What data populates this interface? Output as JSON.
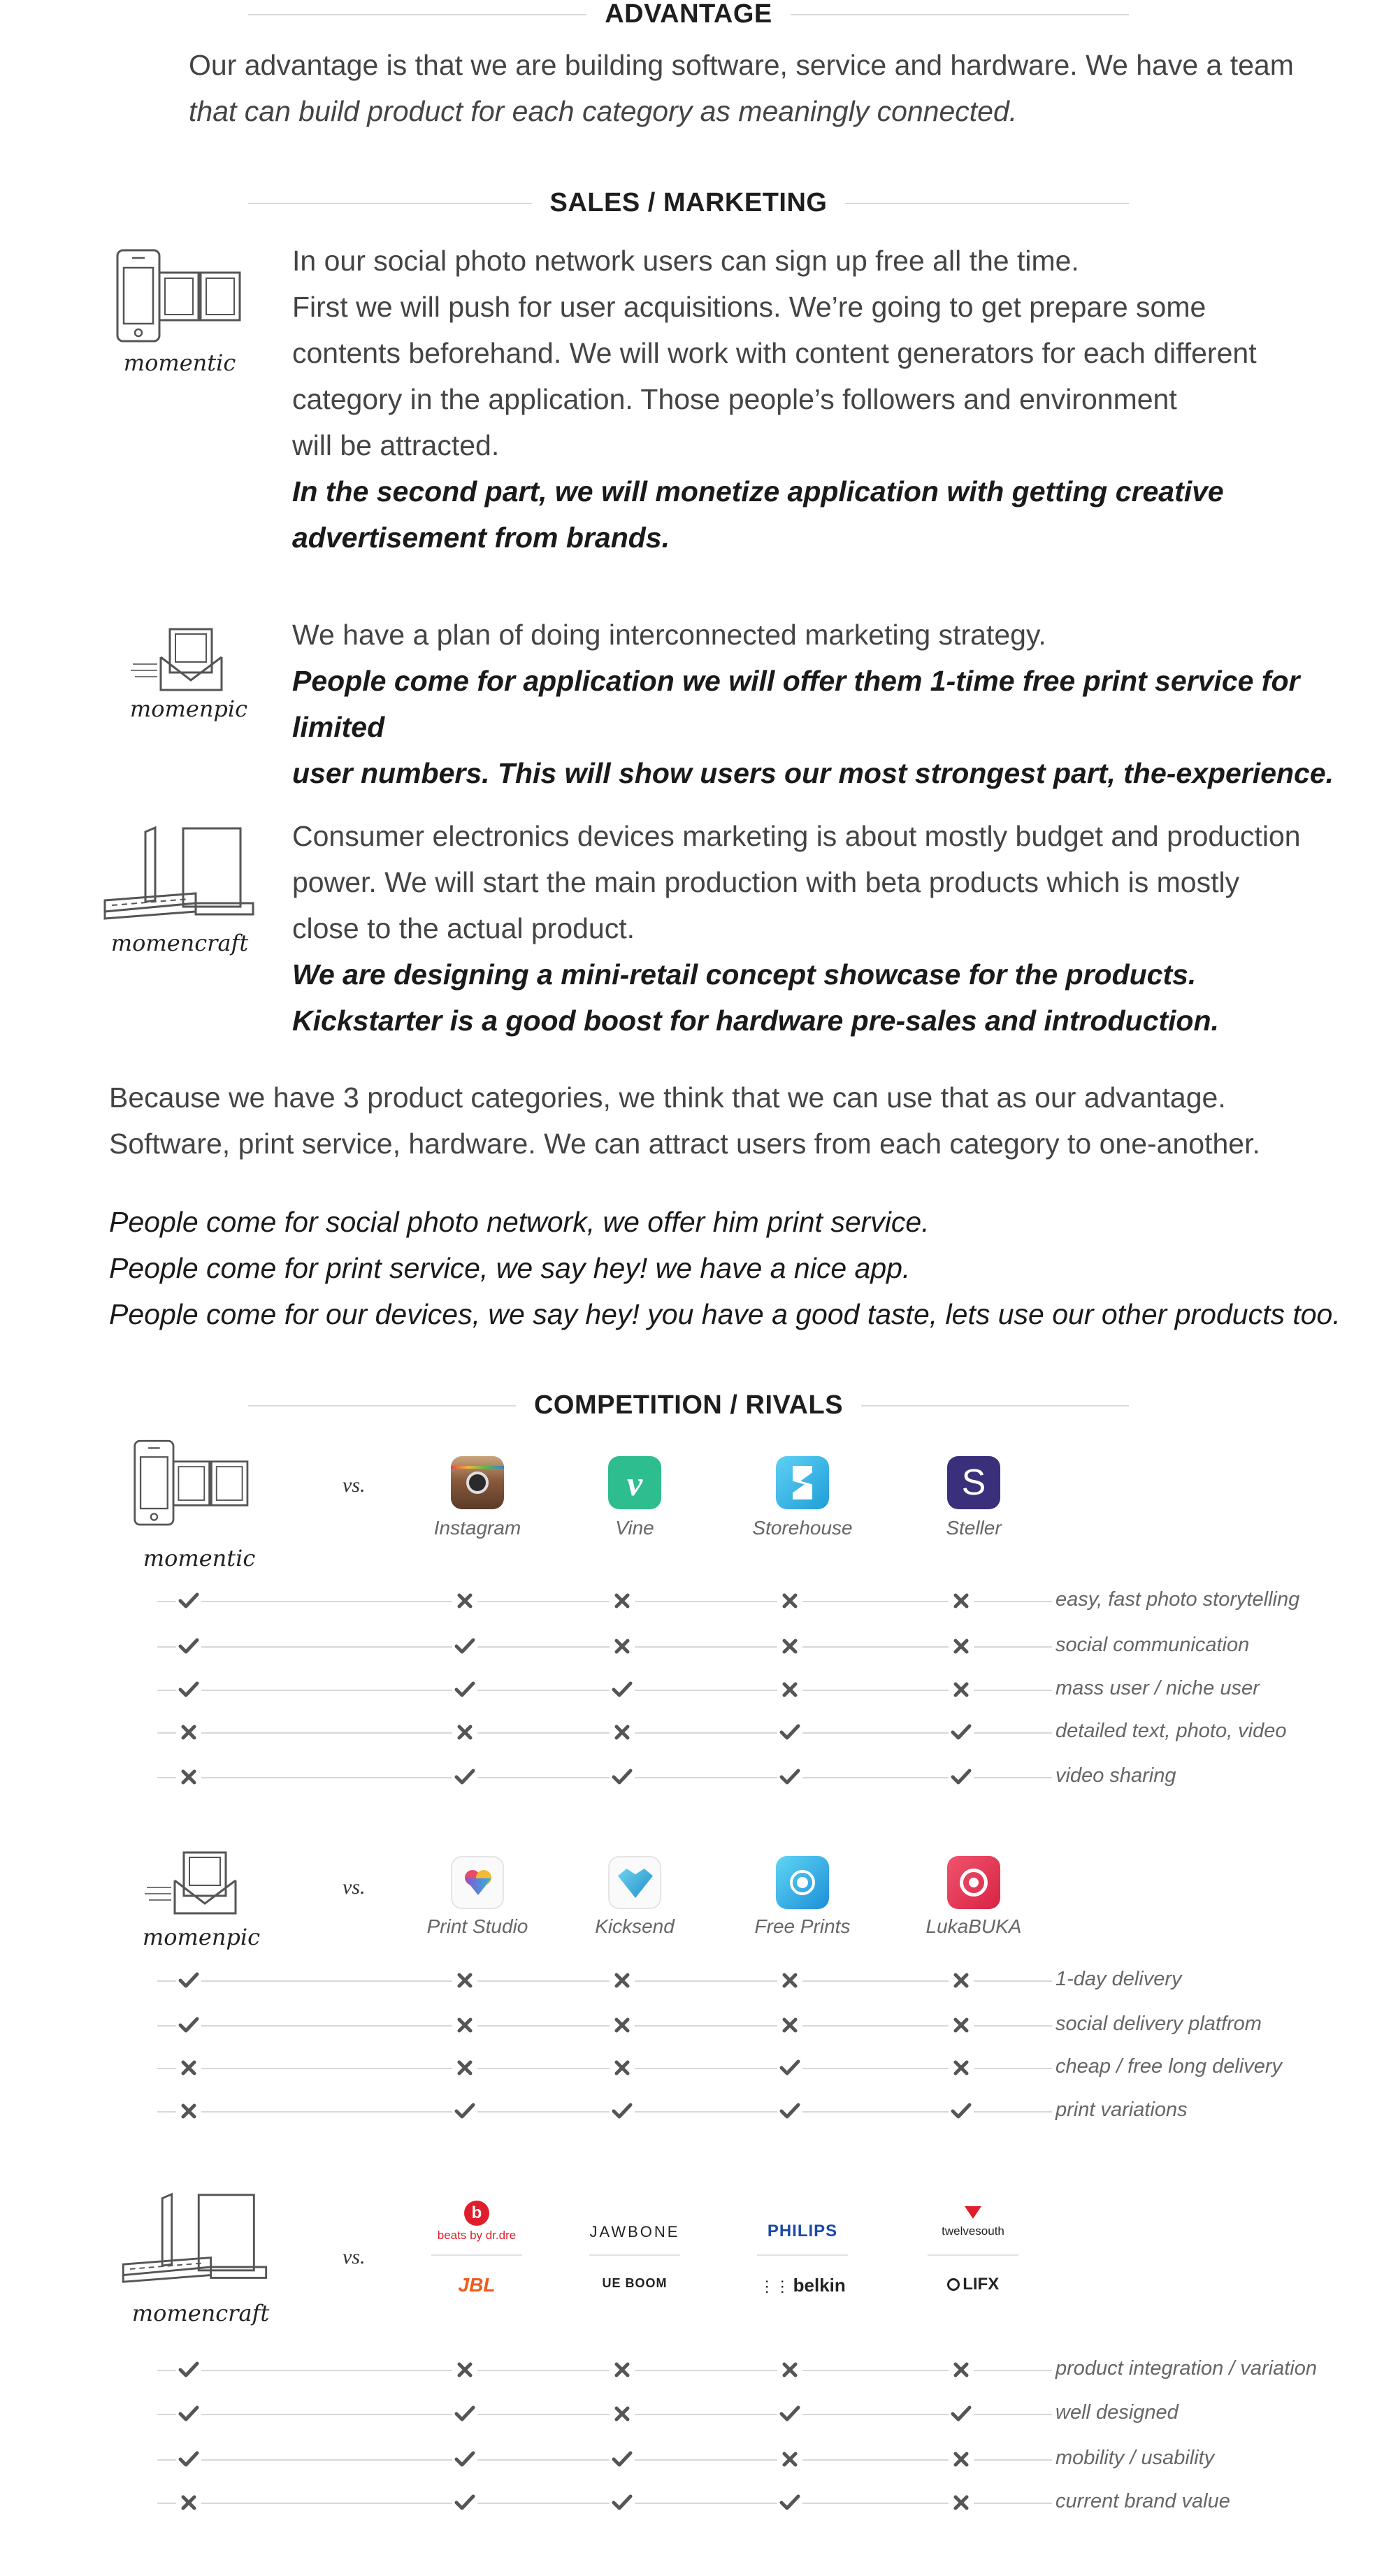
{
  "advantage": {
    "heading": "ADVANTAGE",
    "line1": "Our advantage is that we are building software, service and hardware. We have a team",
    "line2": "that can build product for each category as meaningly connected."
  },
  "sales": {
    "heading": "SALES / MARKETING",
    "momentic": {
      "label": "momentic",
      "lines": [
        "In our social photo network users can sign up free all the time.",
        "First we will push for user acquisitions. We’re going to get prepare some",
        "contents beforehand. We will work with content generators for each different",
        "category in the application. Those people’s followers and environment",
        "will be attracted."
      ],
      "bold_lines": [
        "In the second part, we will monetize application with getting creative",
        "advertisement from brands."
      ]
    },
    "momenpic": {
      "label": "momenpic",
      "lines": [
        "We have a plan of doing interconnected marketing strategy."
      ],
      "bold_lines": [
        "People come for application we will offer them 1-time free print service for limited",
        "user numbers. This will show users our most strongest part, the-experience."
      ]
    },
    "momencraft": {
      "label": "momencraft",
      "lines": [
        "Consumer electronics devices marketing is about mostly budget and production",
        "power. We will start the main production with beta products which is mostly",
        "close to the actual product."
      ],
      "bold_lines": [
        "We are designing a mini-retail concept showcase for the products.",
        "Kickstarter is a good boost for hardware pre-sales and introduction."
      ]
    },
    "summary": [
      "Because we have 3 product categories, we think that we can use that as our advantage.",
      "Software, print service, hardware. We can attract users from each category to one-another."
    ],
    "italic_summary": [
      "People come for social photo network, we offer him print service.",
      "People come for print service, we say hey! we have a nice app.",
      "People come for our devices, we say hey! you have a good taste, lets use our other products too."
    ]
  },
  "competition": {
    "heading": "COMPETITION / RIVALS",
    "vs_label": "vs.",
    "groups": [
      {
        "product": "momentic",
        "rivals": [
          {
            "name": "Instagram",
            "icon": "instagram-icon",
            "color": "#8a5a3c"
          },
          {
            "name": "Vine",
            "icon": "vine-icon",
            "color": "#2ebd8f"
          },
          {
            "name": "Storehouse",
            "icon": "storehouse-icon",
            "color": "#2fb7e8"
          },
          {
            "name": "Steller",
            "icon": "steller-icon",
            "color": "#3a2f7a"
          }
        ],
        "features": [
          {
            "label": "easy, fast photo storytelling",
            "marks": [
              "check",
              "cross",
              "cross",
              "cross",
              "cross"
            ]
          },
          {
            "label": "social communication",
            "marks": [
              "check",
              "check",
              "cross",
              "cross",
              "cross"
            ]
          },
          {
            "label": "mass user / niche user",
            "marks": [
              "check",
              "check",
              "check",
              "cross",
              "cross"
            ]
          },
          {
            "label": "detailed text, photo, video",
            "marks": [
              "cross",
              "cross",
              "cross",
              "check",
              "check"
            ]
          },
          {
            "label": "video sharing",
            "marks": [
              "cross",
              "check",
              "check",
              "check",
              "check"
            ]
          }
        ]
      },
      {
        "product": "momenpic",
        "rivals": [
          {
            "name": "Print Studio",
            "icon": "print-studio-icon",
            "color": "#e84a6a"
          },
          {
            "name": "Kicksend",
            "icon": "kicksend-icon",
            "color": "#3ab3d9"
          },
          {
            "name": "Free Prints",
            "icon": "free-prints-icon",
            "color": "#2a9fe0"
          },
          {
            "name": "LukaBUKA",
            "icon": "lukabuka-icon",
            "color": "#e8334f"
          }
        ],
        "features": [
          {
            "label": "1-day delivery",
            "marks": [
              "check",
              "cross",
              "cross",
              "cross",
              "cross"
            ]
          },
          {
            "label": "social delivery platfrom",
            "marks": [
              "check",
              "cross",
              "cross",
              "cross",
              "cross"
            ]
          },
          {
            "label": "cheap / free long delivery",
            "marks": [
              "cross",
              "cross",
              "cross",
              "check",
              "cross"
            ]
          },
          {
            "label": "print variations",
            "marks": [
              "cross",
              "check",
              "check",
              "check",
              "check"
            ]
          }
        ]
      },
      {
        "product": "momencraft",
        "brands": [
          {
            "top": "beats by dr.dre",
            "bottom": "JBL"
          },
          {
            "top": "JAWBONE",
            "bottom": "UE BOOM"
          },
          {
            "top": "PHILIPS",
            "bottom": "belkin"
          },
          {
            "top": "twelvesouth",
            "bottom": "LIFX"
          }
        ],
        "features": [
          {
            "label": "product integration / variation",
            "marks": [
              "check",
              "cross",
              "cross",
              "cross",
              "cross"
            ]
          },
          {
            "label": "well designed",
            "marks": [
              "check",
              "check",
              "cross",
              "check",
              "check"
            ]
          },
          {
            "label": "mobility / usability",
            "marks": [
              "check",
              "check",
              "check",
              "cross",
              "cross"
            ]
          },
          {
            "label": "current brand value",
            "marks": [
              "cross",
              "check",
              "check",
              "check",
              "cross"
            ]
          }
        ]
      }
    ]
  }
}
